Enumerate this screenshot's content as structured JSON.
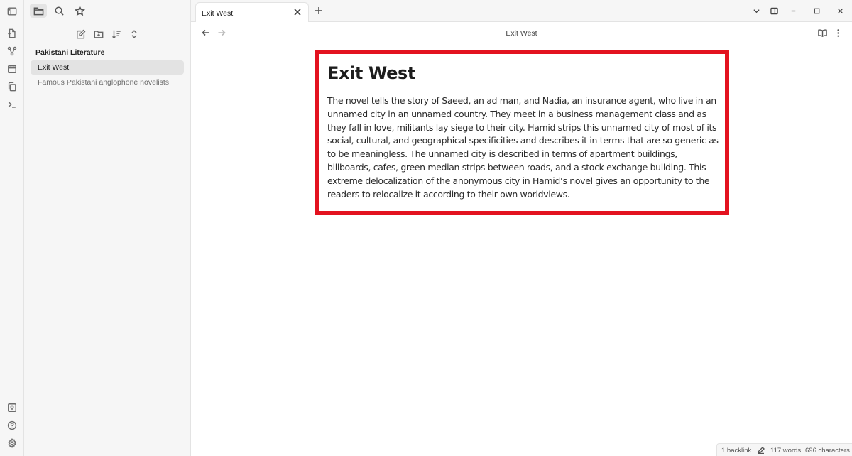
{
  "sidebar": {
    "vault_title": "Pakistani Literature",
    "files": [
      {
        "label": "Exit West",
        "active": true
      },
      {
        "label": "Famous Pakistani anglophone novelists",
        "active": false
      }
    ]
  },
  "tabs": [
    {
      "label": "Exit West"
    }
  ],
  "view": {
    "title": "Exit West"
  },
  "note": {
    "heading": "Exit West",
    "body": "The novel tells the story of Saeed, an ad man, and Nadia, an insurance agent, who live in an unnamed city in an unnamed country. They meet in a business management class and as they fall in love, militants lay siege to their city. Hamid strips this unnamed city of most of its social, cultural, and geographical specificities and describes it in terms that are so generic as to be meaningless. The unnamed city is described in terms of apartment buildings, billboards, cafes, green median strips between roads, and a stock exchange building. This extreme delocalization of the anonymous city in Hamid’s novel gives an opportunity to the readers to relocalize it according to their own worldviews."
  },
  "status": {
    "backlinks": "1 backlink",
    "words": "117 words",
    "characters": "696 characters"
  },
  "colors": {
    "highlight": "#e3121f",
    "sidebar_bg": "#f6f6f6",
    "active_item_bg": "#e3e3e3"
  },
  "icons": {
    "ribbon": [
      "sidebar-toggle-icon",
      "new-note-icon",
      "graph-icon",
      "calendar-icon",
      "copy-icon",
      "terminal-icon",
      "vault-icon",
      "help-icon",
      "settings-icon"
    ],
    "sidebar_tabs": [
      "folder-icon",
      "search-icon",
      "star-icon"
    ],
    "sidebar_tools": [
      "new-note-icon",
      "new-folder-icon",
      "sort-icon",
      "collapse-icon"
    ]
  }
}
